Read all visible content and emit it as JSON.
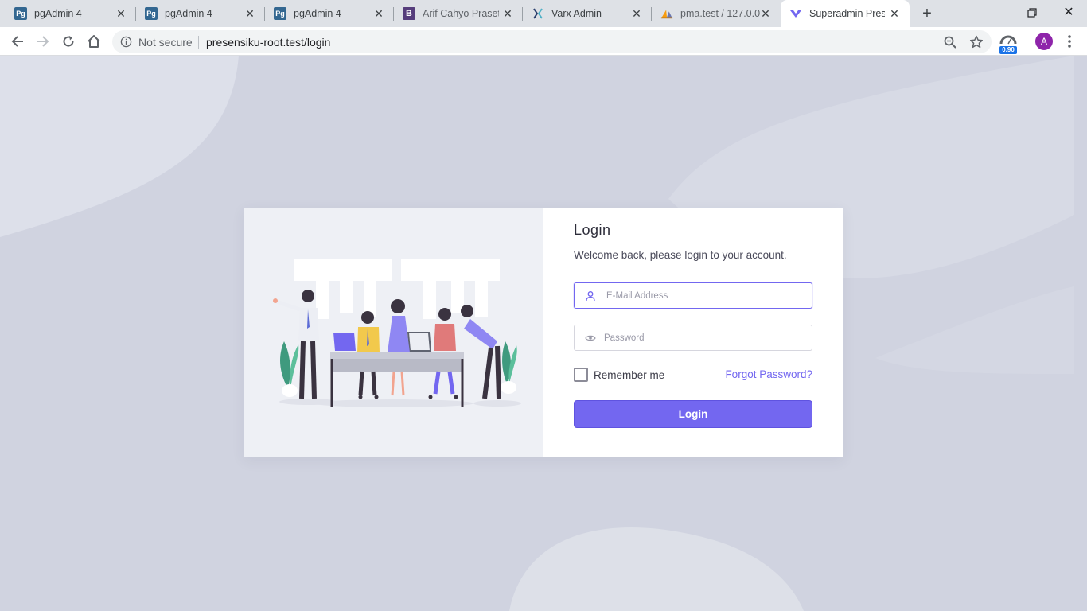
{
  "browser": {
    "tabs": [
      {
        "label": "pgAdmin 4",
        "favicon": "pg",
        "favicon_color": "#336791"
      },
      {
        "label": "pgAdmin 4",
        "favicon": "pg",
        "favicon_color": "#336791"
      },
      {
        "label": "pgAdmin 4",
        "favicon": "pg",
        "favicon_color": "#336791"
      },
      {
        "label": "Arif Cahyo Prasety",
        "favicon": "B",
        "favicon_color": "#563d7c"
      },
      {
        "label": "Varx Admin",
        "favicon": "varx-logo-icon",
        "favicon_color": "#2a3f6d"
      },
      {
        "label": "pma.test / 127.0.0",
        "favicon": "phpmyadmin-sail-icon",
        "favicon_color": "#f89c0e"
      },
      {
        "label": "Superadmin Prese",
        "favicon": "heart-logo-icon",
        "favicon_color": "#7367f0"
      }
    ],
    "active_tab_index": 6,
    "address": {
      "security_label": "Not secure",
      "url": "presensiku-root.test/login"
    },
    "extension_badge": "0.90",
    "profile_initial": "A"
  },
  "login": {
    "title": "Login",
    "subtitle": "Welcome back, please login to your account.",
    "email_placeholder": "E-Mail Address",
    "email_value": "",
    "password_placeholder": "Password",
    "password_value": "",
    "remember_label": "Remember me",
    "remember_checked": false,
    "forgot_label": "Forgot Password?",
    "submit_label": "Login"
  },
  "colors": {
    "accent": "#7367f0",
    "page_background": "#d0d3e0",
    "illustration_panel": "#eef0f5"
  }
}
